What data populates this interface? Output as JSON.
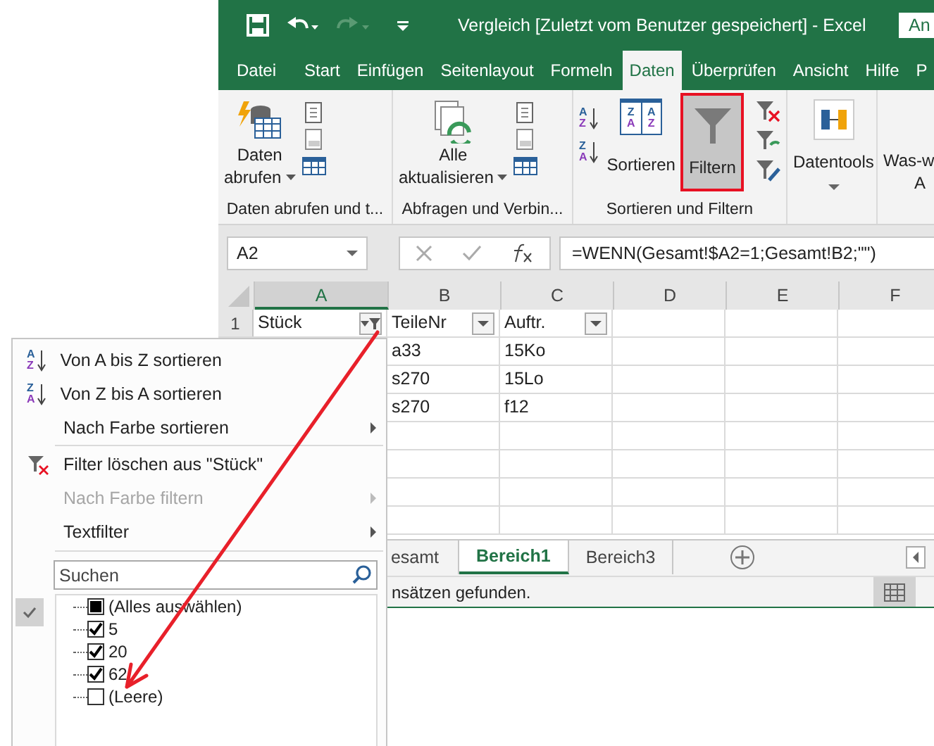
{
  "title_bar": {
    "title": "Vergleich [Zuletzt vom Benutzer gespeichert]  -  Excel",
    "account_button": "An"
  },
  "tabs": [
    {
      "label": "Datei",
      "selected": false
    },
    {
      "label": "Start",
      "selected": false
    },
    {
      "label": "Einfügen",
      "selected": false
    },
    {
      "label": "Seitenlayout",
      "selected": false
    },
    {
      "label": "Formeln",
      "selected": false
    },
    {
      "label": "Daten",
      "selected": true
    },
    {
      "label": "Überprüfen",
      "selected": false
    },
    {
      "label": "Ansicht",
      "selected": false
    },
    {
      "label": "Hilfe",
      "selected": false
    },
    {
      "label": "P",
      "selected": false
    }
  ],
  "ribbon": {
    "groups": [
      {
        "label": "Daten abrufen und t...",
        "buttons": [
          {
            "lines": [
              "Daten",
              "abrufen"
            ],
            "dropdown": true,
            "pressed": false,
            "highlighted": false
          }
        ]
      },
      {
        "label": "Abfragen und Verbin...",
        "buttons": [
          {
            "lines": [
              "Alle",
              "aktualisieren"
            ],
            "dropdown": true,
            "pressed": false,
            "highlighted": false
          }
        ]
      },
      {
        "label": "Sortieren und Filtern",
        "sort_icons": [
          [
            "A",
            "Z"
          ],
          [
            "Z",
            "A"
          ]
        ],
        "buttons": [
          {
            "lines": [
              "Sortieren"
            ],
            "icon_letters": [
              [
                "Z",
                "A"
              ],
              [
                "A",
                "Z"
              ]
            ],
            "dropdown": false,
            "pressed": false,
            "highlighted": false
          },
          {
            "lines": [
              "Filtern"
            ],
            "dropdown": false,
            "pressed": true,
            "highlighted": true
          }
        ]
      },
      {
        "buttons": [
          {
            "lines": [
              "Datentools"
            ],
            "dropdown": true,
            "pressed": false,
            "highlighted": false
          }
        ]
      },
      {
        "buttons": [
          {
            "lines": [
              "Was-w",
              "A"
            ],
            "dropdown": false,
            "pressed": false,
            "highlighted": false
          }
        ]
      }
    ]
  },
  "formula_bar": {
    "name_box": "A2",
    "formula": "=WENN(Gesamt!$A2=1;Gesamt!B2;\"\")"
  },
  "grid": {
    "columns": [
      {
        "label": "A",
        "selected": true
      },
      {
        "label": "B",
        "selected": false
      },
      {
        "label": "C",
        "selected": false
      },
      {
        "label": "D",
        "selected": false
      },
      {
        "label": "E",
        "selected": false
      },
      {
        "label": "F",
        "selected": false
      }
    ],
    "header_row": {
      "number": "1",
      "cells": [
        {
          "text": "Stück",
          "filtered": true
        },
        {
          "text": "TeileNr",
          "filtered": false
        },
        {
          "text": "Auftr.",
          "filtered": false
        }
      ]
    },
    "rows": [
      [
        "a33",
        "15Ko"
      ],
      [
        "s270",
        "15Lo"
      ],
      [
        "s270",
        "f12"
      ]
    ]
  },
  "sheet_tabs": [
    {
      "label": "esamt",
      "selected": false
    },
    {
      "label": "Bereich1",
      "selected": true
    },
    {
      "label": "Bereich3",
      "selected": false
    }
  ],
  "status_bar": {
    "text": "nsätzen gefunden."
  },
  "filter_menu": {
    "items": [
      {
        "kind": "sort_ascending",
        "icon_letters": [
          "A",
          "Z"
        ],
        "label": "Von A bis Z sortieren",
        "disabled": false,
        "submenu": false
      },
      {
        "kind": "sort_descending",
        "icon_letters": [
          "Z",
          "A"
        ],
        "label": "Von Z bis A sortieren",
        "disabled": false,
        "submenu": false
      },
      {
        "kind": "plain",
        "label": "Nach Farbe sortieren",
        "disabled": false,
        "submenu": true
      },
      {
        "kind": "separator"
      },
      {
        "kind": "clear_filter",
        "label": "Filter löschen aus \"Stück\"",
        "disabled": false,
        "submenu": false
      },
      {
        "kind": "plain",
        "label": "Nach Farbe filtern",
        "disabled": true,
        "submenu": true
      },
      {
        "kind": "plain",
        "label": "Textfilter",
        "disabled": false,
        "submenu": true
      }
    ],
    "search": {
      "placeholder": "Suchen"
    },
    "values": [
      {
        "label": "(Alles auswählen)",
        "checked": false,
        "indeterminate": true
      },
      {
        "label": "5",
        "checked": true,
        "indeterminate": false
      },
      {
        "label": "20",
        "checked": true,
        "indeterminate": false
      },
      {
        "label": "62",
        "checked": true,
        "indeterminate": false
      },
      {
        "label": "(Leere)",
        "checked": false,
        "indeterminate": false
      }
    ]
  }
}
